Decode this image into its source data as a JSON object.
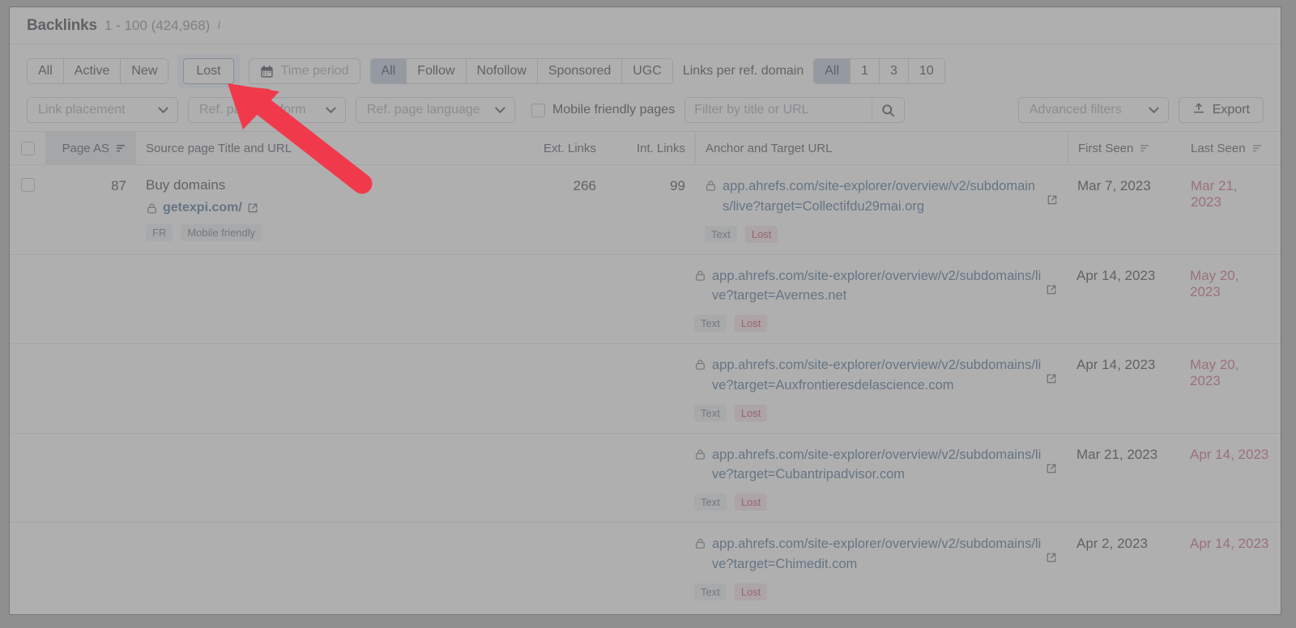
{
  "header": {
    "title": "Backlinks",
    "range": "1 - 100 (424,968)",
    "info_icon": "info-icon"
  },
  "filters": {
    "status_segments": [
      {
        "label": "All",
        "state": "normal"
      },
      {
        "label": "Active",
        "state": "normal"
      },
      {
        "label": "New",
        "state": "normal"
      }
    ],
    "lost_label": "Lost",
    "time_period": {
      "label": "Time period",
      "icon": "calendar-icon"
    },
    "follow_segments": [
      {
        "label": "All",
        "state": "active"
      },
      {
        "label": "Follow",
        "state": "normal"
      },
      {
        "label": "Nofollow",
        "state": "normal"
      },
      {
        "label": "Sponsored",
        "state": "normal"
      },
      {
        "label": "UGC",
        "state": "normal"
      }
    ],
    "links_per_domain_label": "Links per ref. domain",
    "links_per_domain_segments": [
      {
        "label": "All",
        "state": "active"
      },
      {
        "label": "1",
        "state": "normal"
      },
      {
        "label": "3",
        "state": "normal"
      },
      {
        "label": "10",
        "state": "normal"
      }
    ],
    "link_placement": "Link placement",
    "ref_page_platform": "Ref. page platform",
    "ref_page_language": "Ref. page language",
    "mobile_friendly_label": "Mobile friendly pages",
    "mobile_friendly_checked": false,
    "search_placeholder": "Filter by title or URL",
    "search_value": "",
    "search_icon": "search-icon",
    "advanced_filters": "Advanced filters",
    "export_label": "Export",
    "export_icon": "upload-icon"
  },
  "table": {
    "columns": [
      {
        "key": "checkbox",
        "label": ""
      },
      {
        "key": "page_as",
        "label": "Page AS",
        "sorted": true
      },
      {
        "key": "source",
        "label": "Source page Title and URL"
      },
      {
        "key": "ext_links",
        "label": "Ext. Links"
      },
      {
        "key": "int_links",
        "label": "Int. Links"
      },
      {
        "key": "anchor",
        "label": "Anchor and Target URL"
      },
      {
        "key": "first_seen",
        "label": "First Seen",
        "sorted": false
      },
      {
        "key": "last_seen",
        "label": "Last Seen",
        "sorted": false
      }
    ],
    "rows": [
      {
        "page_as": "87",
        "source_title": "Buy domains",
        "source_url": "getexpi.com/",
        "source_tags": [
          "FR",
          "Mobile friendly"
        ],
        "ext_links": "266",
        "int_links": "99",
        "links": [
          {
            "url": "app.ahrefs.com/site-explorer/overview/v2/subdomains/live?target=Collectifdu29mai.org",
            "tags": [
              "Text",
              "Lost"
            ],
            "first_seen": "Mar 7, 2023",
            "last_seen": "Mar 21, 2023"
          },
          {
            "url": "app.ahrefs.com/site-explorer/overview/v2/subdomains/live?target=Avernes.net",
            "tags": [
              "Text",
              "Lost"
            ],
            "first_seen": "Apr 14, 2023",
            "last_seen": "May 20, 2023"
          },
          {
            "url": "app.ahrefs.com/site-explorer/overview/v2/subdomains/live?target=Auxfrontieresdelascience.com",
            "tags": [
              "Text",
              "Lost"
            ],
            "first_seen": "Apr 14, 2023",
            "last_seen": "May 20, 2023"
          },
          {
            "url": "app.ahrefs.com/site-explorer/overview/v2/subdomains/live?target=Cubantripadvisor.com",
            "tags": [
              "Text",
              "Lost"
            ],
            "first_seen": "Mar 21, 2023",
            "last_seen": "Apr 14, 2023"
          },
          {
            "url": "app.ahrefs.com/site-explorer/overview/v2/subdomains/live?target=Chimedit.com",
            "tags": [
              "Text",
              "Lost"
            ],
            "first_seen": "Apr 2, 2023",
            "last_seen": "Apr 14, 2023"
          }
        ]
      }
    ]
  },
  "annotation": {
    "arrow_color": "#f03a4b",
    "points_to": "Lost"
  },
  "colors": {
    "accent_blue": "#38618c",
    "lost_red": "#c03a52",
    "segment_active": "#b9c3da",
    "arrow": "#f03a4b"
  }
}
